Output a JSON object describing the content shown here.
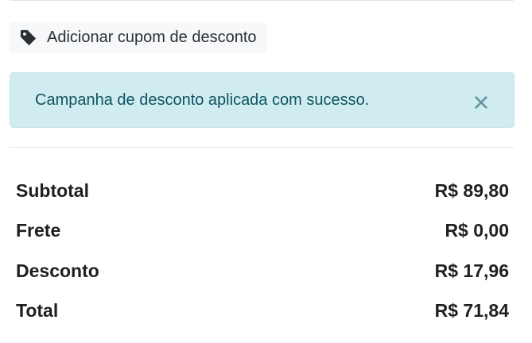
{
  "coupon": {
    "label": "Adicionar cupom de desconto",
    "icon": "tag-icon"
  },
  "alert": {
    "message": "Campanha de desconto aplicada com sucesso.",
    "close_icon": "close-icon",
    "colors": {
      "background": "#d1ecf1",
      "text": "#0c5460"
    }
  },
  "summary": {
    "rows": [
      {
        "label": "Subtotal",
        "value": "R$ 89,80"
      },
      {
        "label": "Frete",
        "value": "R$ 0,00"
      },
      {
        "label": "Desconto",
        "value": "R$ 17,96"
      },
      {
        "label": "Total",
        "value": "R$ 71,84"
      }
    ]
  }
}
